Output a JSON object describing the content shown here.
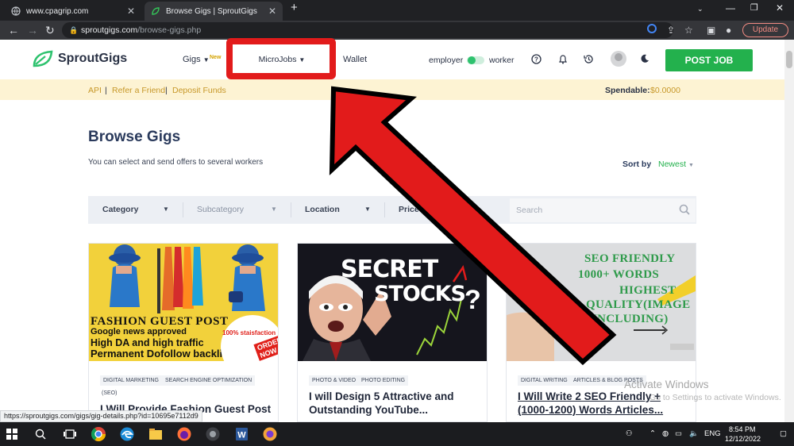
{
  "browser": {
    "tabs": [
      {
        "title": "www.cpagrip.com",
        "active": false
      },
      {
        "title": "Browse Gigs | SproutGigs",
        "active": true
      }
    ],
    "new_tab_symbol": "+",
    "url_domain": "sproutgigs.com",
    "url_path": "/browse-gigs.php",
    "update_label": "Update"
  },
  "header": {
    "logo_text": "SproutGigs",
    "nav": {
      "gigs": "Gigs",
      "gigs_badge": "New",
      "microjobs": "MicroJobs",
      "wallet": "Wallet"
    },
    "mode": {
      "employer": "employer",
      "worker": "worker"
    },
    "post_job_label": "POST JOB"
  },
  "subbar": {
    "links": [
      "API",
      "Refer a Friend",
      "Deposit Funds"
    ],
    "separator": "|",
    "spendable_label": "Spendable:",
    "spendable_value": "$0.0000"
  },
  "main": {
    "title": "Browse Gigs",
    "subtitle": "You can select and send offers to several workers",
    "sort_label": "Sort by",
    "sort_value": "Newest",
    "filters": [
      "Category",
      "Subcategory",
      "Location",
      "Price"
    ],
    "search_placeholder": "Search"
  },
  "cards": [
    {
      "thumb_lines": [
        "FASHION GUEST POST",
        "Google news approved",
        "High DA and high traffic",
        "Permanent Dofollow backlinks"
      ],
      "thumb_badge": "100% staisfaction",
      "thumb_cta": "ORDER NOW",
      "tags": [
        "DIGITAL MARKETING",
        "SEARCH ENGINE OPTIMIZATION",
        "(SEO)"
      ],
      "title": "I Will Provide Fashion Guest Post On High Authority"
    },
    {
      "thumb_lines": [
        "SECRET",
        "STOCKS",
        "?"
      ],
      "tags": [
        "PHOTO & VIDEO",
        "PHOTO EDITING"
      ],
      "title": "I will Design 5 Attractive and Outstanding YouTube..."
    },
    {
      "thumb_lines": [
        "SEO FRIENDLY",
        "1000+ WORDS",
        "HIGHEST",
        "QUALITY(IMAGE",
        "INCLUDING)"
      ],
      "tags": [
        "DIGITAL WRITING",
        "ARTICLES & BLOG POSTS"
      ],
      "title": "I Will Write 2 SEO Friendly + (1000-1200) Words Articles..."
    }
  ],
  "status_url": "https://sproutgigs.com/gigs/gig-details.php?id=10695e7112d9",
  "watermark": {
    "title": "Activate Windows",
    "subtitle": "Go to Settings to activate Windows."
  },
  "taskbar": {
    "lang": "ENG",
    "time": "8:54 PM",
    "date": "12/12/2022"
  },
  "colors": {
    "brand_green": "#23b14d",
    "accent_gold": "#c7982a",
    "highlight_red": "#e21b1b"
  }
}
